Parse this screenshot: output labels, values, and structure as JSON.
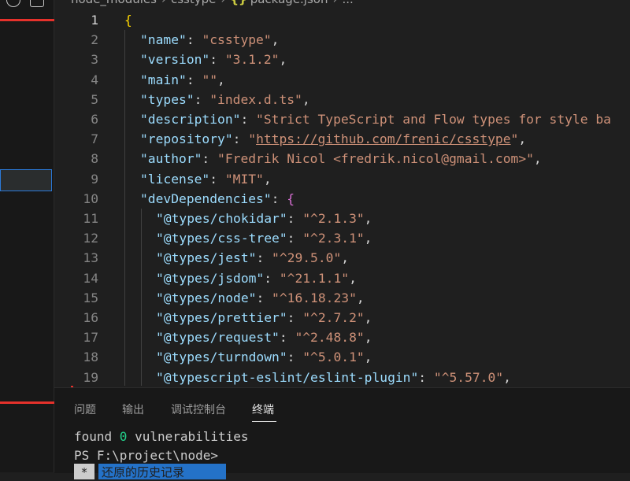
{
  "breadcrumb": [
    "node_modules",
    "csstype",
    "package.json",
    "..."
  ],
  "icons": {
    "json_file": "{}",
    "top_left": "circle-icon"
  },
  "editor": {
    "lines": [
      {
        "n": "1",
        "segs": [
          {
            "t": "{",
            "c": "b1"
          }
        ]
      },
      {
        "n": "2",
        "segs": [
          {
            "t": "\"name\"",
            "c": "k"
          },
          {
            "t": ": ",
            "c": "p"
          },
          {
            "t": "\"csstype\"",
            "c": "s"
          },
          {
            "t": ",",
            "c": "p"
          }
        ]
      },
      {
        "n": "3",
        "segs": [
          {
            "t": "\"version\"",
            "c": "k"
          },
          {
            "t": ": ",
            "c": "p"
          },
          {
            "t": "\"3.1.2\"",
            "c": "s"
          },
          {
            "t": ",",
            "c": "p"
          }
        ]
      },
      {
        "n": "4",
        "segs": [
          {
            "t": "\"main\"",
            "c": "k"
          },
          {
            "t": ": ",
            "c": "p"
          },
          {
            "t": "\"\"",
            "c": "s"
          },
          {
            "t": ",",
            "c": "p"
          }
        ]
      },
      {
        "n": "5",
        "segs": [
          {
            "t": "\"types\"",
            "c": "k"
          },
          {
            "t": ": ",
            "c": "p"
          },
          {
            "t": "\"index.d.ts\"",
            "c": "s"
          },
          {
            "t": ",",
            "c": "p"
          }
        ]
      },
      {
        "n": "6",
        "segs": [
          {
            "t": "\"description\"",
            "c": "k"
          },
          {
            "t": ": ",
            "c": "p"
          },
          {
            "t": "\"Strict TypeScript and Flow types for style ba",
            "c": "s"
          }
        ]
      },
      {
        "n": "7",
        "segs": [
          {
            "t": "\"repository\"",
            "c": "k"
          },
          {
            "t": ": ",
            "c": "p"
          },
          {
            "t": "\"",
            "c": "s"
          },
          {
            "t": "https://github.com/frenic/csstype",
            "c": "s u"
          },
          {
            "t": "\"",
            "c": "s"
          },
          {
            "t": ",",
            "c": "p"
          }
        ]
      },
      {
        "n": "8",
        "segs": [
          {
            "t": "\"author\"",
            "c": "k"
          },
          {
            "t": ": ",
            "c": "p"
          },
          {
            "t": "\"Fredrik Nicol <fredrik.nicol@gmail.com>\"",
            "c": "s"
          },
          {
            "t": ",",
            "c": "p"
          }
        ]
      },
      {
        "n": "9",
        "segs": [
          {
            "t": "\"license\"",
            "c": "k"
          },
          {
            "t": ": ",
            "c": "p"
          },
          {
            "t": "\"MIT\"",
            "c": "s"
          },
          {
            "t": ",",
            "c": "p"
          }
        ]
      },
      {
        "n": "10",
        "segs": [
          {
            "t": "\"devDependencies\"",
            "c": "k"
          },
          {
            "t": ": ",
            "c": "p"
          },
          {
            "t": "{",
            "c": "b2"
          }
        ]
      },
      {
        "n": "11",
        "segs": [
          {
            "t": "\"@types/chokidar\"",
            "c": "k"
          },
          {
            "t": ": ",
            "c": "p"
          },
          {
            "t": "\"^2.1.3\"",
            "c": "s"
          },
          {
            "t": ",",
            "c": "p"
          }
        ]
      },
      {
        "n": "12",
        "segs": [
          {
            "t": "\"@types/css-tree\"",
            "c": "k"
          },
          {
            "t": ": ",
            "c": "p"
          },
          {
            "t": "\"^2.3.1\"",
            "c": "s"
          },
          {
            "t": ",",
            "c": "p"
          }
        ]
      },
      {
        "n": "13",
        "segs": [
          {
            "t": "\"@types/jest\"",
            "c": "k"
          },
          {
            "t": ": ",
            "c": "p"
          },
          {
            "t": "\"^29.5.0\"",
            "c": "s"
          },
          {
            "t": ",",
            "c": "p"
          }
        ]
      },
      {
        "n": "14",
        "segs": [
          {
            "t": "\"@types/jsdom\"",
            "c": "k"
          },
          {
            "t": ": ",
            "c": "p"
          },
          {
            "t": "\"^21.1.1\"",
            "c": "s"
          },
          {
            "t": ",",
            "c": "p"
          }
        ]
      },
      {
        "n": "15",
        "segs": [
          {
            "t": "\"@types/node\"",
            "c": "k"
          },
          {
            "t": ": ",
            "c": "p"
          },
          {
            "t": "\"^16.18.23\"",
            "c": "s"
          },
          {
            "t": ",",
            "c": "p"
          }
        ]
      },
      {
        "n": "16",
        "segs": [
          {
            "t": "\"@types/prettier\"",
            "c": "k"
          },
          {
            "t": ": ",
            "c": "p"
          },
          {
            "t": "\"^2.7.2\"",
            "c": "s"
          },
          {
            "t": ",",
            "c": "p"
          }
        ]
      },
      {
        "n": "17",
        "segs": [
          {
            "t": "\"@types/request\"",
            "c": "k"
          },
          {
            "t": ": ",
            "c": "p"
          },
          {
            "t": "\"^2.48.8\"",
            "c": "s"
          },
          {
            "t": ",",
            "c": "p"
          }
        ]
      },
      {
        "n": "18",
        "segs": [
          {
            "t": "\"@types/turndown\"",
            "c": "k"
          },
          {
            "t": ": ",
            "c": "p"
          },
          {
            "t": "\"^5.0.1\"",
            "c": "s"
          },
          {
            "t": ",",
            "c": "p"
          }
        ]
      },
      {
        "n": "19",
        "segs": [
          {
            "t": "\"@typescript-eslint/eslint-plugin\"",
            "c": "k"
          },
          {
            "t": ": ",
            "c": "p"
          },
          {
            "t": "\"^5.57.0\"",
            "c": "s"
          },
          {
            "t": ",",
            "c": "p"
          }
        ]
      }
    ]
  },
  "panel": {
    "tabs": [
      "问题",
      "输出",
      "调试控制台",
      "终端"
    ],
    "terminal": {
      "found": "found ",
      "zero": "0",
      "vuln": " vulnerabilities",
      "prompt": "PS F:\\project\\node>",
      "star": "*",
      "history": "还原的历史记录"
    }
  }
}
